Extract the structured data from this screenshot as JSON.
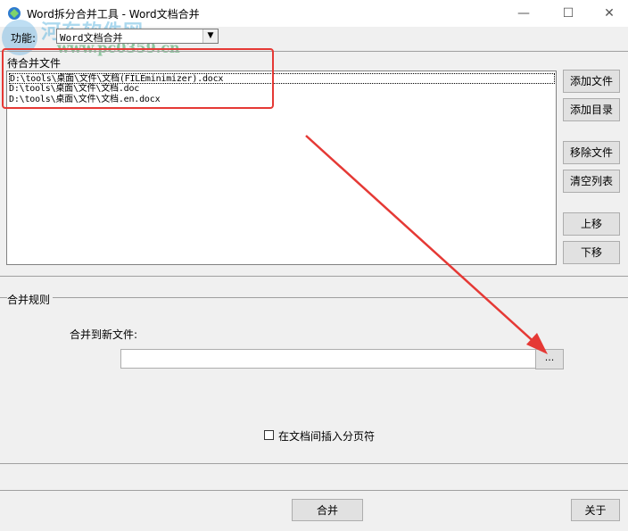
{
  "window": {
    "title": "Word拆分合并工具 - Word文档合并",
    "minimize": "—",
    "maximize": "☐",
    "close": "✕"
  },
  "watermark": {
    "name": "河东软件网",
    "url": "www.pc0359.cn"
  },
  "function_row": {
    "label": "功能:",
    "selected": "Word文档合并",
    "arrow": "▼"
  },
  "files_section": {
    "title": "待合并文件",
    "items": [
      "D:\\tools\\桌面\\文件\\文档(FILEminimizer).docx",
      "D:\\tools\\桌面\\文件\\文档.doc",
      "D:\\tools\\桌面\\文件\\文档.en.docx"
    ],
    "buttons": {
      "add_file": "添加文件",
      "add_dir": "添加目录",
      "remove_file": "移除文件",
      "clear_list": "清空列表",
      "move_up": "上移",
      "move_down": "下移"
    }
  },
  "rules_section": {
    "title": "合并规则",
    "merge_to_label": "合并到新文件:",
    "path_value": "",
    "browse": "...",
    "page_break_label": "在文档间插入分页符",
    "page_break_checked": false
  },
  "footer": {
    "merge": "合并",
    "about": "关于"
  },
  "colors": {
    "annotation_red": "#e53935",
    "window_bg": "#f0f0f0"
  }
}
